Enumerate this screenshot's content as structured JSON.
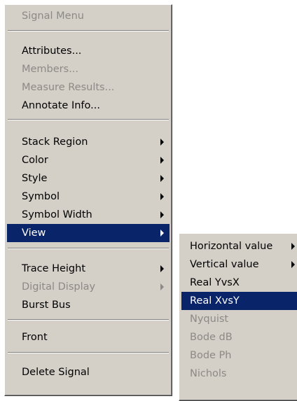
{
  "menu": {
    "title": "Signal Menu",
    "items": [
      {
        "label": "Attributes..."
      },
      {
        "label": "Members..."
      },
      {
        "label": "Measure Results..."
      },
      {
        "label": "Annotate Info..."
      },
      {
        "label": "Stack Region"
      },
      {
        "label": "Color"
      },
      {
        "label": "Style"
      },
      {
        "label": "Symbol"
      },
      {
        "label": "Symbol Width"
      },
      {
        "label": "View"
      },
      {
        "label": "Trace Height"
      },
      {
        "label": "Digital Display"
      },
      {
        "label": "Burst Bus"
      },
      {
        "label": "Front"
      },
      {
        "label": "Delete Signal"
      }
    ]
  },
  "submenu": {
    "items": [
      {
        "label": "Horizontal value"
      },
      {
        "label": "Vertical value"
      },
      {
        "label": "Real YvsX"
      },
      {
        "label": "Real XvsY"
      },
      {
        "label": "Nyquist"
      },
      {
        "label": "Bode dB"
      },
      {
        "label": "Bode Ph"
      },
      {
        "label": "Nichols"
      }
    ]
  },
  "colors": {
    "menu_bg": "#d4d0c8",
    "highlight": "#0a246a",
    "disabled_text": "#8c8a86"
  }
}
